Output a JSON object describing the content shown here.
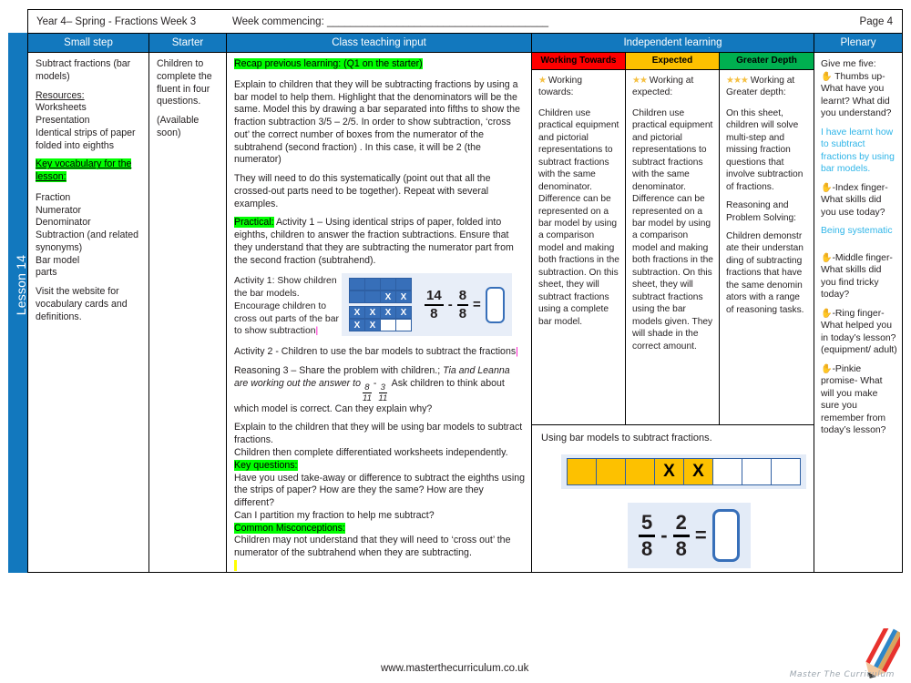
{
  "header": {
    "year_term": "Year 4– Spring - Fractions Week 3",
    "week_commencing": "Week commencing: ______________________________________",
    "page": "Page 4"
  },
  "spine": {
    "lesson_label": "Lesson 14",
    "color": "#1278be"
  },
  "columns": {
    "small_step": "Small step",
    "starter": "Starter",
    "class_teaching_input": "Class teaching input",
    "independent_learning": "Independent learning",
    "plenary": "Plenary"
  },
  "small_step": {
    "title": "Subtract fractions (bar models)",
    "resources_heading": "Resources:",
    "resources": "Worksheets\nPresentation\nIdentical strips of paper folded into eighths",
    "key_vocab_heading": "Key vocabulary for the lesson:",
    "vocab": "Fraction\nNumerator\nDenominator\nSubtraction (and related synonyms)\nBar model\nparts",
    "website_note": "Visit the website for vocabulary cards and definitions."
  },
  "starter": {
    "text": "Children to complete the fluent in four questions.",
    "note": "(Available soon)"
  },
  "class_input": {
    "recap_heading": "Recap previous learning: (Q1 on the starter)",
    "para1": "Explain to children that they will be subtracting fractions by using a bar model to help them.  Highlight that the denominators will be the same. Model this by drawing a bar separated into fifths to show the fraction subtraction  3/5 – 2/5.  In order to show subtraction, ‘cross out’ the correct number of boxes from the numerator of the subtrahend (second fraction) . In this case, it will be 2 (the numerator)",
    "para2": "They will need to do this systematically (point out that all the crossed-out parts need to be together). Repeat with several examples.",
    "practical_label": "Practical:",
    "practical_text": "Activity 1 – Using identical strips of paper, folded into eighths, children to answer the fraction subtractions.  Ensure that they understand that they are subtracting the numerator part from the second fraction (subtrahend).",
    "activity1_text": "Activity 1: Show children the bar models. Encourage children to cross out parts of the bar to show subtraction",
    "activity1_equation": {
      "fraction1": {
        "num": "14",
        "den": "8"
      },
      "operator": "-",
      "fraction2": {
        "num": "8",
        "den": "8"
      },
      "equals": "="
    },
    "activity1_bar_top": [
      "",
      "",
      "X",
      "X"
    ],
    "activity1_bar_top_row1": [
      "",
      "",
      "",
      ""
    ],
    "activity1_bar_bottom_row1": [
      "X",
      "X",
      "X",
      "X"
    ],
    "activity1_bar_bottom_row2": [
      "X",
      "X",
      "",
      ""
    ],
    "activity2": "Activity 2 - Children to use the bar models to subtract the fractions",
    "reasoning_pre": "Reasoning 3 – Share the problem with children.;",
    "reasoning_italic1": "Tia and Leanna are working out the answer to",
    "reasoning_fraction1": {
      "num": "8",
      "den": "11"
    },
    "reasoning_operator": "-",
    "reasoning_fraction2": {
      "num": "3",
      "den": "11"
    },
    "reasoning_post": "Ask children to think about which model is correct. Can they explain why?",
    "para3": "Explain to the children that they will be using bar models to subtract fractions.",
    "para4": "Children then complete differentiated worksheets independently.",
    "key_questions_heading": "Key questions:",
    "key_questions": "Have you used take-away or difference to subtract the eighths using the strips of paper? How are they the same? How are they different?\nCan I partition my fraction to help me subtract?",
    "misconceptions_heading": "Common Misconceptions:",
    "misconceptions": "Children may not understand that they will need to ‘cross out’ the numerator of the subtrahend when they are subtracting."
  },
  "independent": {
    "bands": [
      {
        "label": "Working Towards",
        "color": "#fe0000"
      },
      {
        "label": "Expected",
        "color": "#fdc100"
      },
      {
        "label": "Greater Depth",
        "color": "#00b050"
      }
    ],
    "working_towards": {
      "stars": "★",
      "heading": "Working towards:",
      "body": "Children use practical equipment and pictorial representations to subtract fractions with the same denominator. Difference can be represented on a bar model by using a comparison model and making both fractions in the subtraction. On this sheet, they will subtract fractions using a complete bar model."
    },
    "expected": {
      "stars": "★★",
      "heading": "Working at expected:",
      "body": "Children use practical equipment and pictorial representations to subtract fractions with the same denominator. Difference can be represented on a bar model by using a comparison model and making both fractions in the subtraction. On this sheet, they will subtract fractions using the bar models given. They will shade in the correct amount."
    },
    "greater_depth": {
      "stars": "★★★",
      "heading": "Working at Greater depth:",
      "body1": "On this sheet, children will solve multi-step and missing fraction questions that involve subtraction of fractions.",
      "body2": "Reasoning and Problem Solving:",
      "body3": "Children demonstr ate their understan ding of subtracting fractions that have the same denomin ators with a range of reasoning tasks."
    },
    "bar_panel": {
      "title": "Using bar models to subtract fractions.",
      "bar_cells": [
        {
          "fill": true,
          "label": ""
        },
        {
          "fill": true,
          "label": ""
        },
        {
          "fill": true,
          "label": ""
        },
        {
          "fill": true,
          "label": "X"
        },
        {
          "fill": true,
          "label": "X"
        },
        {
          "fill": false,
          "label": ""
        },
        {
          "fill": false,
          "label": ""
        },
        {
          "fill": false,
          "label": ""
        }
      ],
      "equation": {
        "fraction1": {
          "num": "5",
          "den": "8"
        },
        "operator": "-",
        "fraction2": {
          "num": "2",
          "den": "8"
        },
        "equals": "="
      }
    }
  },
  "plenary": {
    "give_me_five": "Give me five:",
    "thumbs_icon": "✋",
    "thumbs": "Thumbs up- What have you learnt? What did you understand?",
    "answer1": "I have learnt how to subtract fractions by using bar models.",
    "index": "-Index finger- What skills did  you use today?",
    "answer2": "Being systematic",
    "middle": "-Middle finger- What skills did you find tricky today?",
    "ring": "-Ring finger- What helped you in today’s lesson? (equipment/ adult)",
    "pinkie": "-Pinkie promise- What will you make sure you remember from today’s lesson?"
  },
  "footer": {
    "url": "www.masterthecurriculum.co.uk",
    "logo_text": "Master The Curriculum"
  }
}
